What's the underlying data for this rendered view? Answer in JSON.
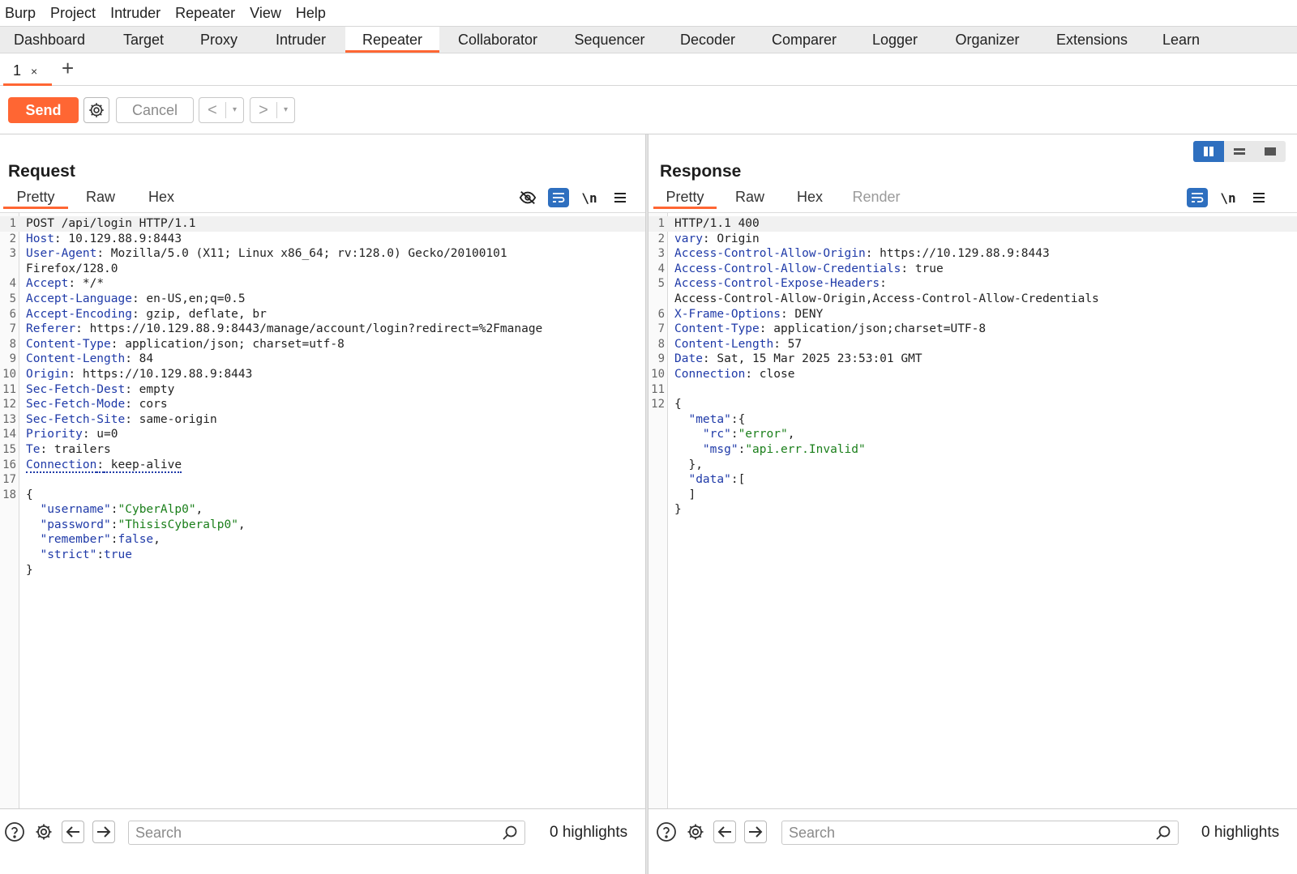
{
  "menu": [
    "Burp",
    "Project",
    "Intruder",
    "Repeater",
    "View",
    "Help"
  ],
  "top_tabs": [
    "Dashboard",
    "Target",
    "Proxy",
    "Intruder",
    "Repeater",
    "Collaborator",
    "Sequencer",
    "Decoder",
    "Comparer",
    "Logger",
    "Organizer",
    "Extensions",
    "Learn"
  ],
  "active_top_tab": "Repeater",
  "sub_tab": {
    "number": "1",
    "close": "×",
    "add": "+"
  },
  "toolbar": {
    "send": "Send",
    "cancel": "Cancel",
    "back": "<",
    "forward": ">",
    "dropdown": "▾"
  },
  "request": {
    "title": "Request",
    "tabs": [
      "Pretty",
      "Raw",
      "Hex"
    ],
    "active_tab": "Pretty",
    "newline_label": "\\n",
    "search_placeholder": "Search",
    "highlights": "0 highlights"
  },
  "response": {
    "title": "Response",
    "tabs": [
      "Pretty",
      "Raw",
      "Hex",
      "Render"
    ],
    "active_tab": "Pretty",
    "newline_label": "\\n",
    "search_placeholder": "Search",
    "highlights": "0 highlights"
  },
  "request_lines": [
    {
      "n": "1",
      "k": "",
      "v": "POST /api/login HTTP/1.1"
    },
    {
      "n": "2",
      "k": "Host",
      "v": " 10.129.88.9:8443"
    },
    {
      "n": "3",
      "k": "User-Agent",
      "v": " Mozilla/5.0 (X11; Linux x86_64; rv:128.0) Gecko/20100101"
    },
    {
      "n": "",
      "k": "",
      "v": "Firefox/128.0"
    },
    {
      "n": "4",
      "k": "Accept",
      "v": " */*"
    },
    {
      "n": "5",
      "k": "Accept-Language",
      "v": " en-US,en;q=0.5"
    },
    {
      "n": "6",
      "k": "Accept-Encoding",
      "v": " gzip, deflate, br"
    },
    {
      "n": "7",
      "k": "Referer",
      "v": " https://10.129.88.9:8443/manage/account/login?redirect=%2Fmanage"
    },
    {
      "n": "8",
      "k": "Content-Type",
      "v": " application/json; charset=utf-8"
    },
    {
      "n": "9",
      "k": "Content-Length",
      "v": " 84"
    },
    {
      "n": "10",
      "k": "Origin",
      "v": " https://10.129.88.9:8443"
    },
    {
      "n": "11",
      "k": "Sec-Fetch-Dest",
      "v": " empty"
    },
    {
      "n": "12",
      "k": "Sec-Fetch-Mode",
      "v": " cors"
    },
    {
      "n": "13",
      "k": "Sec-Fetch-Site",
      "v": " same-origin"
    },
    {
      "n": "14",
      "k": "Priority",
      "v": " u=0"
    },
    {
      "n": "15",
      "k": "Te",
      "v": " trailers"
    },
    {
      "n": "16",
      "k": "Connection",
      "v": " keep-alive"
    },
    {
      "n": "17",
      "k": "",
      "v": ""
    },
    {
      "n": "18",
      "k": "",
      "v": "{"
    }
  ],
  "request_body": [
    {
      "k": "\"username\"",
      "v": "\"CyberAlp0\"",
      "t": "str",
      "end": ","
    },
    {
      "k": "\"password\"",
      "v": "\"ThisisCyberalp0\"",
      "t": "str",
      "end": ","
    },
    {
      "k": "\"remember\"",
      "v": "false",
      "t": "bool",
      "end": ","
    },
    {
      "k": "\"strict\"",
      "v": "true",
      "t": "bool",
      "end": ""
    }
  ],
  "request_body_close": "}",
  "response_lines": [
    {
      "n": "1",
      "k": "",
      "v": "HTTP/1.1 400"
    },
    {
      "n": "2",
      "k": "vary",
      "v": " Origin"
    },
    {
      "n": "3",
      "k": "Access-Control-Allow-Origin",
      "v": " https://10.129.88.9:8443"
    },
    {
      "n": "4",
      "k": "Access-Control-Allow-Credentials",
      "v": " true"
    },
    {
      "n": "5",
      "k": "Access-Control-Expose-Headers",
      "v": ""
    },
    {
      "n": "",
      "k": "",
      "v": "Access-Control-Allow-Origin,Access-Control-Allow-Credentials"
    },
    {
      "n": "6",
      "k": "X-Frame-Options",
      "v": " DENY"
    },
    {
      "n": "7",
      "k": "Content-Type",
      "v": " application/json;charset=UTF-8"
    },
    {
      "n": "8",
      "k": "Content-Length",
      "v": " 57"
    },
    {
      "n": "9",
      "k": "Date",
      "v": " Sat, 15 Mar 2025 23:53:01 GMT"
    },
    {
      "n": "10",
      "k": "Connection",
      "v": " close"
    },
    {
      "n": "11",
      "k": "",
      "v": ""
    },
    {
      "n": "12",
      "k": "",
      "v": "{"
    }
  ],
  "response_body": [
    {
      "indent": "  ",
      "k": "\"meta\"",
      "sep": ":",
      "v": "{",
      "t": "punc"
    },
    {
      "indent": "    ",
      "k": "\"rc\"",
      "sep": ":",
      "v": "\"error\"",
      "t": "str",
      "end": ","
    },
    {
      "indent": "    ",
      "k": "\"msg\"",
      "sep": ":",
      "v": "\"api.err.Invalid\"",
      "t": "str",
      "end": ""
    },
    {
      "indent": "  ",
      "k": "",
      "sep": "",
      "v": "},",
      "t": "punc"
    },
    {
      "indent": "  ",
      "k": "\"data\"",
      "sep": ":",
      "v": "[",
      "t": "punc"
    },
    {
      "indent": "  ",
      "k": "",
      "sep": "",
      "v": "]",
      "t": "punc"
    },
    {
      "indent": "",
      "k": "",
      "sep": "",
      "v": "}",
      "t": "punc"
    }
  ],
  "colors": {
    "accent": "#ff6633",
    "key_blue": "#1f3aa8",
    "string_green": "#1a7f1a",
    "toggle_blue": "#2e6fbf"
  }
}
